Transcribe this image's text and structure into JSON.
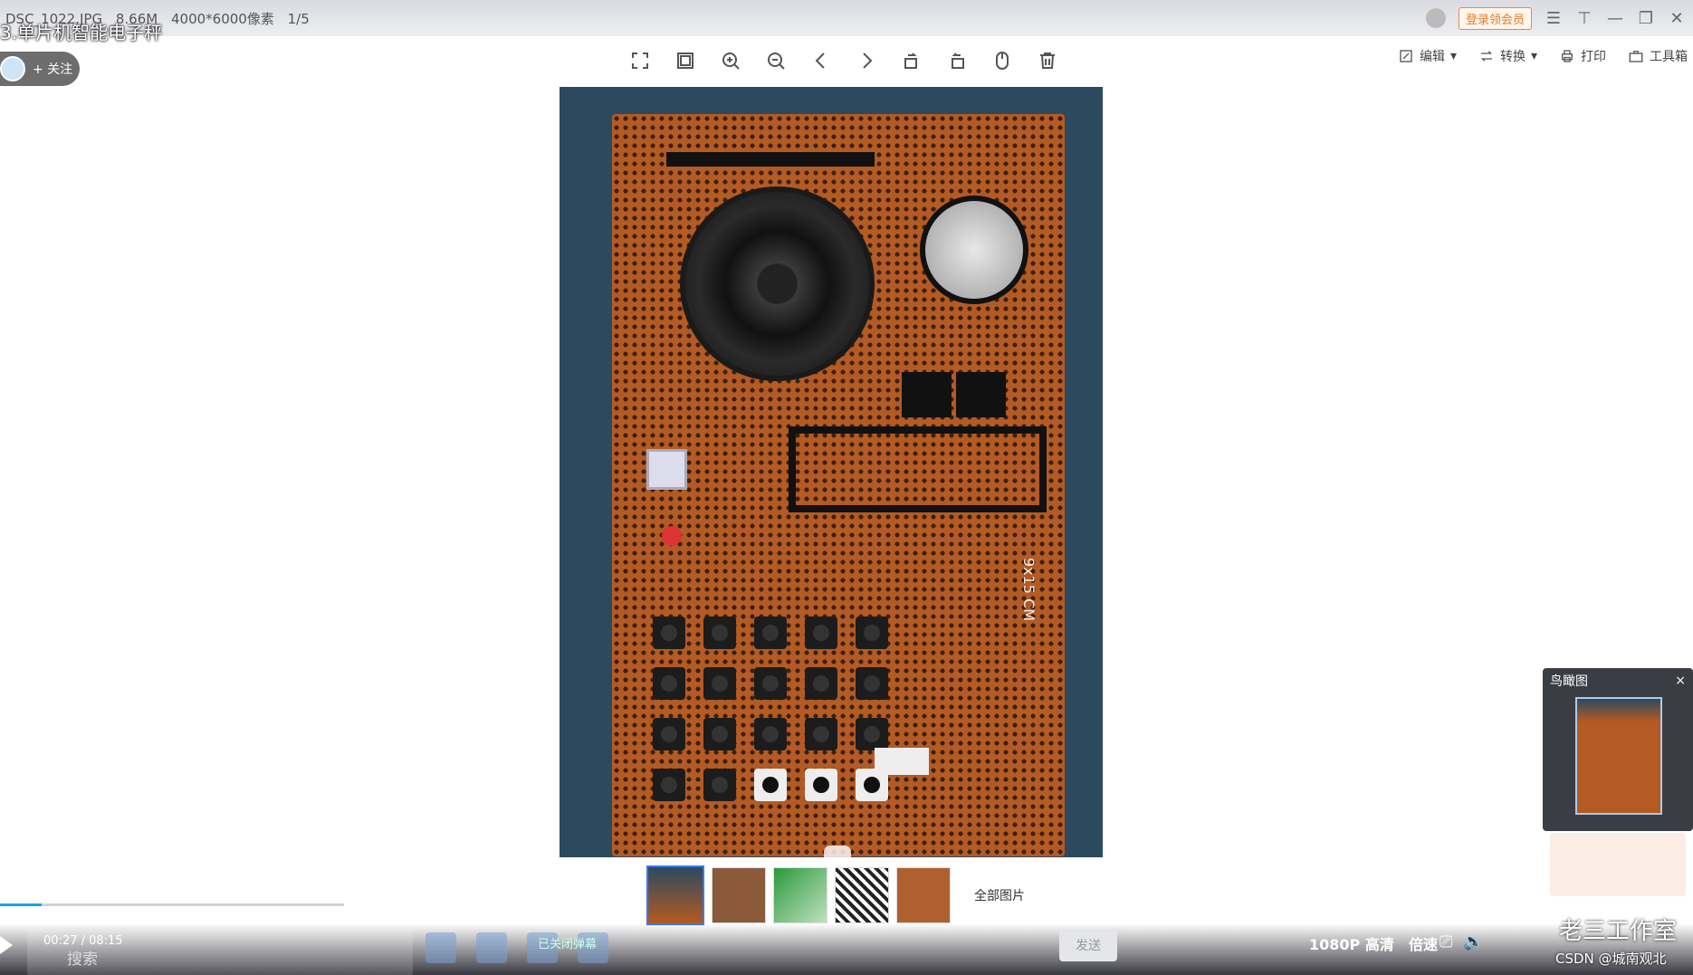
{
  "file_info": {
    "name": "DSC_1022.JPG",
    "size": "8.66M",
    "dimensions": "4000*6000像素",
    "index": "1/5"
  },
  "video": {
    "title": "3.单片机智能电子秤",
    "follow_label": "+ 关注",
    "time": "00:27 / 08:15",
    "progress": 0.055,
    "danmu_status": "已关闭弹幕",
    "send_label": "发送",
    "quality": "1080P 高清",
    "speed": "倍速"
  },
  "topbar": {
    "vip_label": "登录领会员"
  },
  "right_tools": [
    {
      "label": "编辑",
      "icon": "edit-icon"
    },
    {
      "label": "转换",
      "icon": "convert-icon"
    },
    {
      "label": "打印",
      "icon": "print-icon"
    },
    {
      "label": "工具箱",
      "icon": "toolbox-icon"
    }
  ],
  "toolbar_icons": [
    "fullscreen-icon",
    "fit-window-icon",
    "zoom-in-icon",
    "zoom-out-icon",
    "previous-icon",
    "next-icon",
    "rotate-left-icon",
    "rotate-right-icon",
    "ocr-icon",
    "delete-icon"
  ],
  "photo": {
    "size_label": "9x15 CM"
  },
  "thumbnails": {
    "count": 5,
    "active_index": 0,
    "all_label": "全部图片"
  },
  "birdseye": {
    "title": "鸟瞰图",
    "close": "×"
  },
  "search": {
    "label": "搜索"
  },
  "watermark": {
    "studio": "老三工作室",
    "csdn": "CSDN @城南观北"
  },
  "colors": {
    "accent": "#3a78f0",
    "progress": "#1e9fe6",
    "vip": "#e77a2a",
    "board": "#b45a23"
  }
}
